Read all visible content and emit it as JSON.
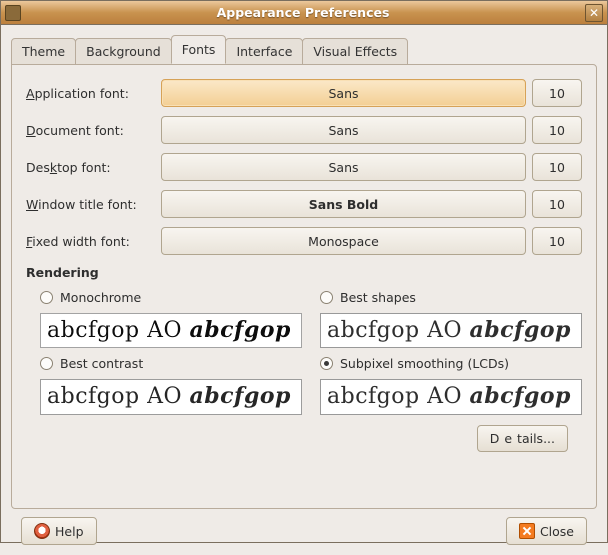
{
  "window": {
    "title": "Appearance Preferences"
  },
  "tabs": {
    "theme": "Theme",
    "background": "Background",
    "fonts": "Fonts",
    "interface": "Interface",
    "visual_effects": "Visual Effects"
  },
  "fonts": {
    "application": {
      "label_pre": "",
      "label_u": "A",
      "label_post": "pplication font:",
      "name": "Sans",
      "size": "10"
    },
    "document": {
      "label_pre": "",
      "label_u": "D",
      "label_post": "ocument font:",
      "name": "Sans",
      "size": "10"
    },
    "desktop": {
      "label_pre": "Des",
      "label_u": "k",
      "label_post": "top font:",
      "name": "Sans",
      "size": "10"
    },
    "window": {
      "label_pre": "",
      "label_u": "W",
      "label_post": "indow title font:",
      "name": "Sans Bold",
      "size": "10"
    },
    "fixed": {
      "label_pre": "",
      "label_u": "F",
      "label_post": "ixed width font:",
      "name": "Monospace",
      "size": "10"
    }
  },
  "rendering": {
    "title": "Rendering",
    "monochrome": {
      "pre": "",
      "u": "M",
      "post": "onochrome"
    },
    "shapes": {
      "pre": "Best ",
      "u": "s",
      "post": "hapes"
    },
    "contrast": {
      "pre": "Best ",
      "u": "c",
      "post": "ontrast"
    },
    "subpixel": {
      "pre": "Sub",
      "u": "p",
      "post": "ixel smoothing (LCDs)"
    },
    "sample_plain": "abcfgop AO ",
    "sample_italic": "abcfgop",
    "selected": "subpixel"
  },
  "buttons": {
    "details": {
      "pre": "D",
      "u": "e",
      "post": "tails..."
    },
    "help": {
      "u": "H",
      "post": "elp"
    },
    "close": {
      "u": "C",
      "post": "lose"
    }
  }
}
